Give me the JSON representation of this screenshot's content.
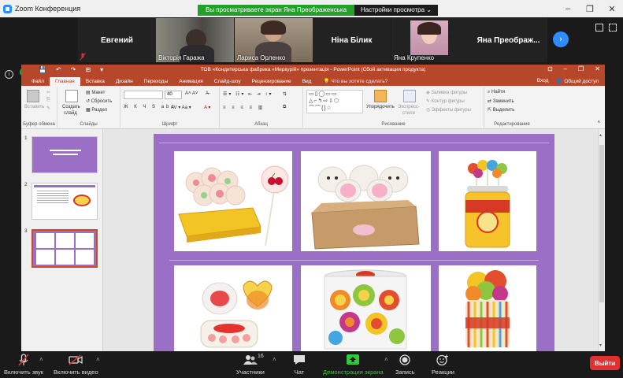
{
  "zoom": {
    "app_title": "Zoom Конференция",
    "share_banner": "Вы просматриваете экран Яна Преображенська",
    "view_options": "Настройки просмотра",
    "view_options_caret": "⌄",
    "window_controls": [
      "–",
      "❐",
      "✕"
    ]
  },
  "participants": [
    {
      "name": "Евгений",
      "caption": "",
      "has_video": false
    },
    {
      "name": "",
      "caption": "Вікторія Гаража",
      "has_video": true
    },
    {
      "name": "",
      "caption": "Лариса Орленко",
      "has_video": true
    },
    {
      "name": "Ніна Білик",
      "caption": "",
      "has_video": false
    },
    {
      "name": "",
      "caption": "Яна Крупенко",
      "has_video": true
    },
    {
      "name": "Яна  Преображ...",
      "caption": "",
      "has_video": false
    }
  ],
  "next_glyph": "›",
  "powerpoint": {
    "title": "ТОВ «Кондитерська фабрика «Меркурій» презентація - PowerPoint (Сбой активации продукта)",
    "qat": [
      "💾",
      "↶",
      "↷",
      "⊞",
      "▾"
    ],
    "controls": [
      "⊡",
      "–",
      "❐",
      "✕"
    ],
    "tabs": [
      "Файл",
      "Главная",
      "Вставка",
      "Дизайн",
      "Переходы",
      "Анимация",
      "Слайд-шоу",
      "Рецензирование",
      "Вид"
    ],
    "active_tab": "Главная",
    "tell_me": "Что вы хотите сделать?",
    "login": "Вход",
    "share": "Общий доступ",
    "ribbon": {
      "clipboard": {
        "label": "Буфер обмена",
        "paste": "Вставить"
      },
      "slides": {
        "label": "Слайды",
        "new_slide": "Создать",
        "new_slide2": "слайд",
        "layout": "Макет",
        "reset": "Сбросить",
        "section": "Раздел"
      },
      "font": {
        "label": "Шрифт",
        "size": "40"
      },
      "paragraph": {
        "label": "Абзац"
      },
      "drawing": {
        "label": "Рисование",
        "arrange": "Упорядочить",
        "quick_styles": "Экспресс-",
        "quick_styles2": "стили",
        "fill": "Заливка фигуры",
        "outline": "Контур фигуры",
        "effects": "Эффекты фигуры"
      },
      "editing": {
        "label": "Редактирование",
        "find": "Найти",
        "replace": "Заменить",
        "select": "Выделить"
      }
    },
    "slide_numbers": [
      "1",
      "2",
      "3"
    ]
  },
  "toolbar": {
    "mute": "Включить звук",
    "video": "Включить видео",
    "participants": "Участники",
    "participants_count": "16",
    "chat": "Чат",
    "share": "Демонстрация экрана",
    "record": "Запись",
    "reactions": "Реакции",
    "leave": "Выйти"
  },
  "colors": {
    "ppt_accent": "#b7472a",
    "slide_bg": "#9a6fc5",
    "zoom_blue": "#2d8cff",
    "share_green": "#22a02a",
    "leave_red": "#e0302f"
  }
}
